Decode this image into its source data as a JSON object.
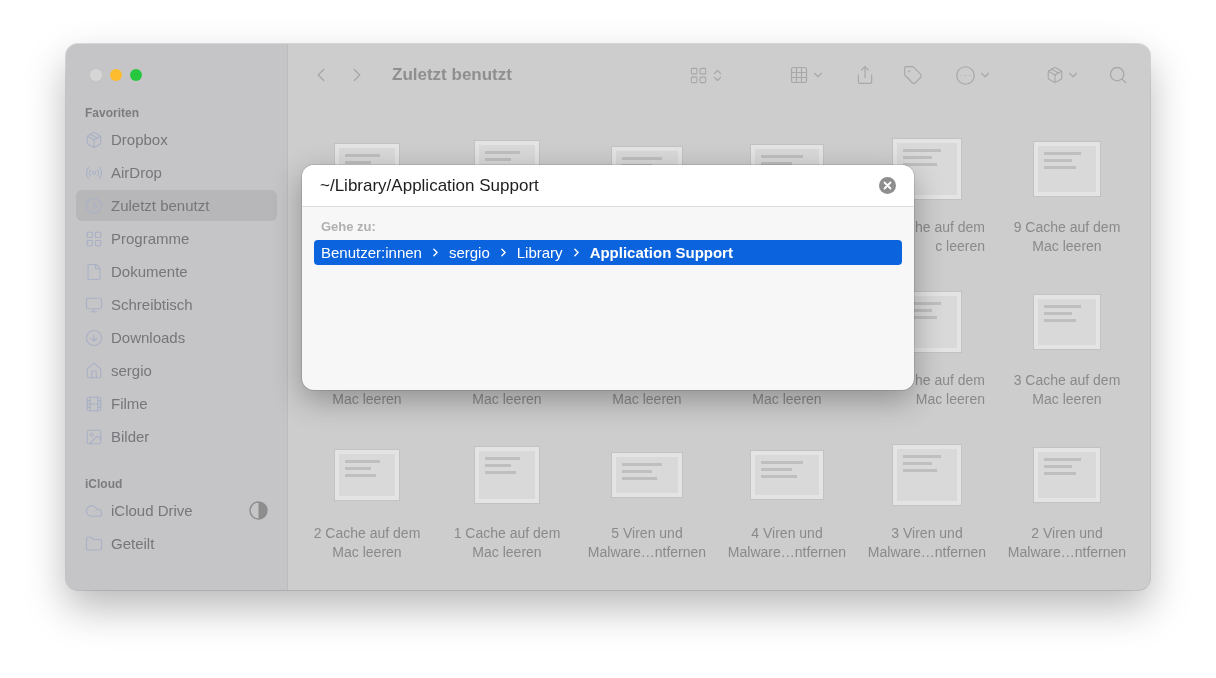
{
  "window": {
    "title": "Zuletzt benutzt"
  },
  "sidebar": {
    "sections": [
      {
        "title": "Favoriten",
        "items": [
          {
            "label": "Dropbox",
            "selected": false
          },
          {
            "label": "AirDrop",
            "selected": false
          },
          {
            "label": "Zuletzt benutzt",
            "selected": true
          },
          {
            "label": "Programme",
            "selected": false
          },
          {
            "label": "Dokumente",
            "selected": false
          },
          {
            "label": "Schreibtisch",
            "selected": false
          },
          {
            "label": "Downloads",
            "selected": false
          },
          {
            "label": "sergio",
            "selected": false
          },
          {
            "label": "Filme",
            "selected": false
          },
          {
            "label": "Bilder",
            "selected": false
          }
        ]
      },
      {
        "title": "iCloud",
        "items": [
          {
            "label": "iCloud Drive",
            "selected": false
          },
          {
            "label": "Geteilt",
            "selected": false
          }
        ]
      }
    ]
  },
  "files": [
    {
      "items": [
        {
          "left_cut": true,
          "lines": [
            "he auf dem",
            "c leeren"
          ]
        },
        {
          "lines": [
            "9 Cache auf dem",
            "Mac leeren"
          ]
        }
      ]
    },
    {
      "items": [
        {
          "top_hidden": true,
          "lines": [
            "Mac leeren"
          ]
        },
        {
          "top_hidden": true,
          "lines": [
            "Mac leeren"
          ]
        },
        {
          "top_hidden": true,
          "lines": [
            "Mac leeren"
          ]
        },
        {
          "top_hidden": true,
          "lines": [
            "Mac leeren"
          ]
        },
        {
          "left_cut": true,
          "lines": [
            "he auf dem",
            "Mac leeren"
          ]
        },
        {
          "lines": [
            "3 Cache auf dem",
            "Mac leeren"
          ]
        }
      ]
    },
    {
      "items": [
        {
          "lines": [
            "2 Cache auf dem",
            "Mac leeren"
          ]
        },
        {
          "lines": [
            "1 Cache auf dem",
            "Mac leeren"
          ]
        },
        {
          "lines": [
            "5 Viren und",
            "Malware…ntfernen"
          ]
        },
        {
          "lines": [
            "4 Viren und",
            "Malware…ntfernen"
          ]
        },
        {
          "lines": [
            "3 Viren und",
            "Malware…ntfernen"
          ]
        },
        {
          "lines": [
            "2 Viren und",
            "Malware…ntfernen"
          ]
        }
      ]
    }
  ],
  "dialog": {
    "value": "~/Library/Application Support",
    "section_label": "Gehe zu:",
    "suggestion": {
      "selected": true,
      "parts": [
        "Benutzer:innen",
        "sergio",
        "Library",
        "Application Support"
      ]
    }
  }
}
